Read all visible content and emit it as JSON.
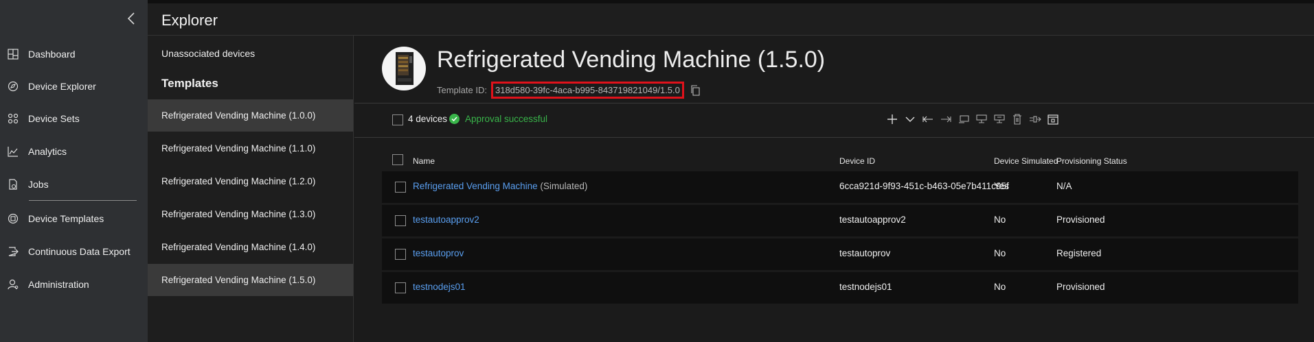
{
  "nav": {
    "items": [
      {
        "label": "Dashboard",
        "icon": "dashboard-icon"
      },
      {
        "label": "Device Explorer",
        "icon": "device-explorer-icon"
      },
      {
        "label": "Device Sets",
        "icon": "device-sets-icon"
      },
      {
        "label": "Analytics",
        "icon": "analytics-icon"
      },
      {
        "label": "Jobs",
        "icon": "jobs-icon"
      },
      {
        "label": "Device Templates",
        "icon": "device-templates-icon"
      },
      {
        "label": "Continuous Data Export",
        "icon": "data-export-icon"
      },
      {
        "label": "Administration",
        "icon": "administration-icon"
      }
    ]
  },
  "explorer": {
    "title": "Explorer",
    "unassociated": "Unassociated devices",
    "templates_heading": "Templates",
    "templates": [
      {
        "label": "Refrigerated Vending Machine (1.0.0)"
      },
      {
        "label": "Refrigerated Vending Machine (1.1.0)"
      },
      {
        "label": "Refrigerated Vending Machine (1.2.0)"
      },
      {
        "label": "Refrigerated Vending Machine (1.3.0)"
      },
      {
        "label": "Refrigerated Vending Machine (1.4.0)"
      },
      {
        "label": "Refrigerated Vending Machine (1.5.0)"
      }
    ]
  },
  "header": {
    "title": "Refrigerated Vending Machine (1.5.0)",
    "template_id_label": "Template ID:",
    "template_id": "318d580-39fc-4aca-b995-843719821049/1.5.0"
  },
  "toolbar": {
    "count": "4 devices",
    "status": "Approval successful",
    "status_color": "#39b54a"
  },
  "table": {
    "columns": {
      "name": "Name",
      "device_id": "Device ID",
      "simulated": "Device Simulated",
      "status": "Provisioning Status"
    },
    "rows": [
      {
        "name": "Refrigerated Vending Machine",
        "suffix": "(Simulated)",
        "device_id": "6cca921d-9f93-451c-b463-05e7b411c95f",
        "simulated": "Yes",
        "status": "N/A"
      },
      {
        "name": "testautoapprov2",
        "suffix": "",
        "device_id": "testautoapprov2",
        "simulated": "No",
        "status": "Provisioned"
      },
      {
        "name": "testautoprov",
        "suffix": "",
        "device_id": "testautoprov",
        "simulated": "No",
        "status": "Registered"
      },
      {
        "name": "testnodejs01",
        "suffix": "",
        "device_id": "testnodejs01",
        "simulated": "No",
        "status": "Provisioned"
      }
    ]
  },
  "colors": {
    "link": "#5a9ff0",
    "highlight_box": "#e0121b"
  }
}
